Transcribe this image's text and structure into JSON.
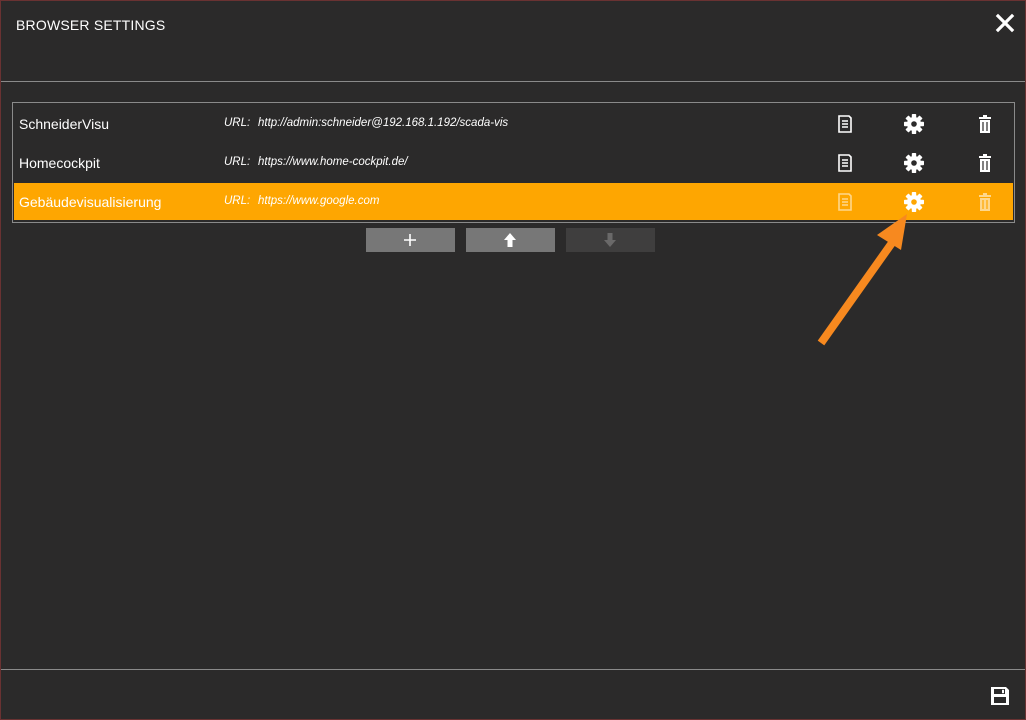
{
  "window": {
    "title": "BROWSER SETTINGS"
  },
  "entries": [
    {
      "name": "SchneiderVisu",
      "url_label": "URL:",
      "url": "http://admin:schneider@192.168.1.192/scada-vis",
      "selected": false
    },
    {
      "name": "Homecockpit",
      "url_label": "URL:",
      "url": "https://www.home-cockpit.de/",
      "selected": false
    },
    {
      "name": "Gebäudevisualisierung",
      "url_label": "URL:",
      "url": "https://www.google.com",
      "selected": true
    }
  ],
  "icons": {
    "close": "close-icon",
    "document": "document-icon",
    "settings": "gear-icon",
    "delete": "trash-icon",
    "add": "plus-icon",
    "move_up": "arrow-up-icon",
    "move_down": "arrow-down-icon",
    "save": "floppy-disk-icon",
    "annotation": "orange-arrow-annotation"
  },
  "colors": {
    "background": "#2b2a2a",
    "selected_row": "#fea601",
    "button": "#777777",
    "button_disabled": "#3f3e3e",
    "annotation_arrow": "#f7891f"
  },
  "controls": {
    "move_down_enabled": false
  }
}
